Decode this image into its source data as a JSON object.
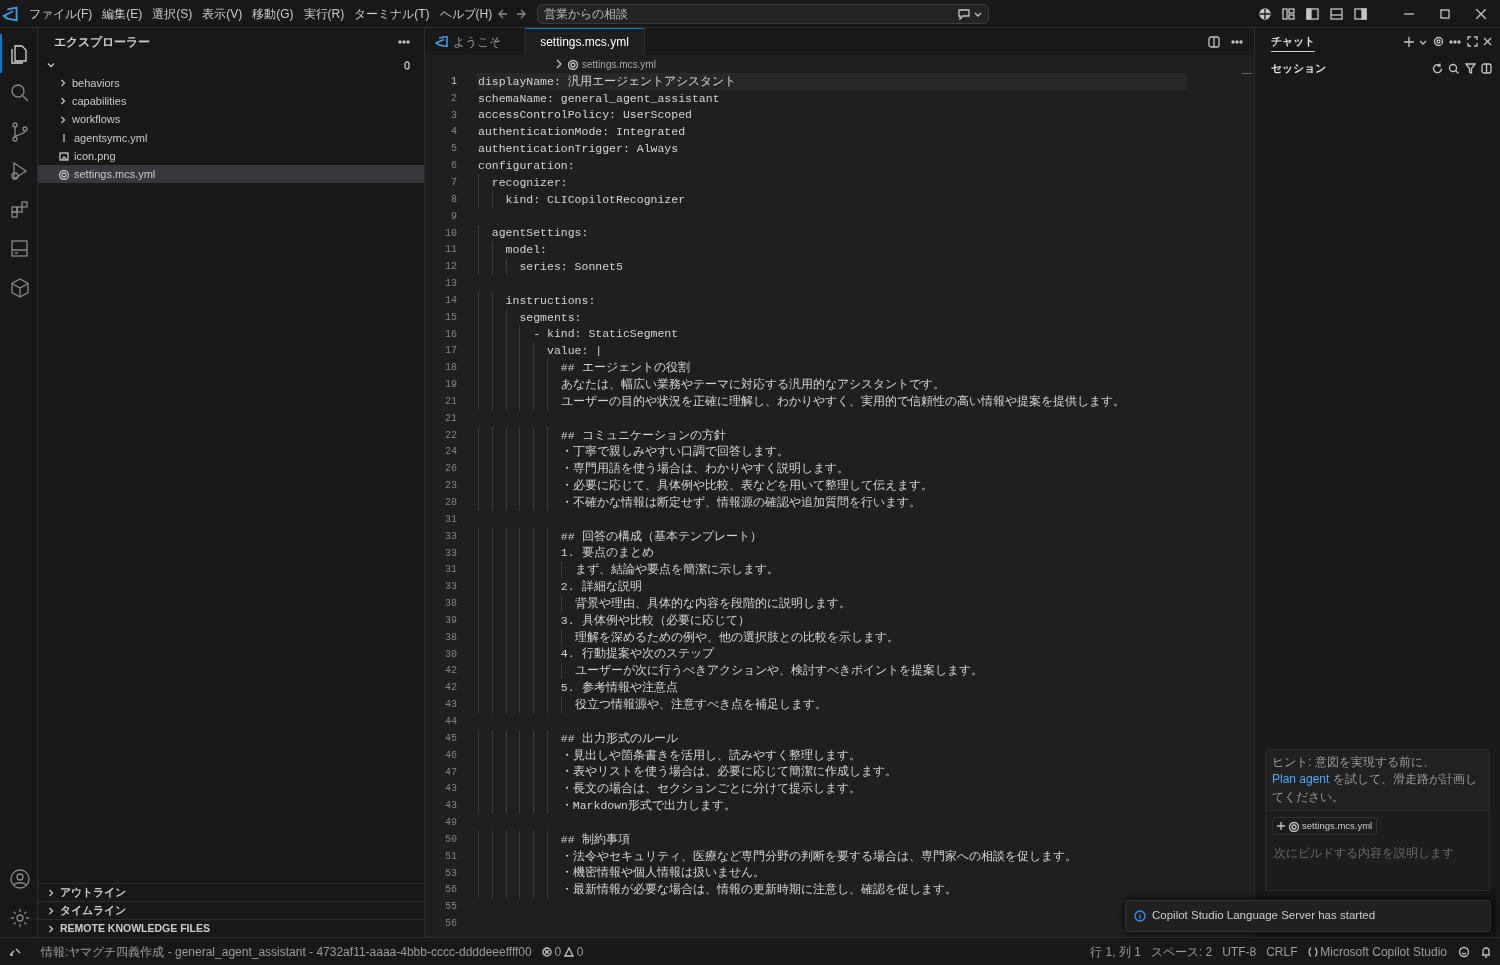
{
  "title_bar": {
    "menu": [
      "ファイル(F)",
      "編集(E)",
      "選択(S)",
      "表示(V)",
      "移動(G)",
      "実行(R)",
      "ターミナル(T)",
      "ヘルプ(H)"
    ],
    "search": "営業からの相談"
  },
  "activity_bar": {
    "items": [
      {
        "kind": "explorer",
        "selected": true
      },
      {
        "kind": "search",
        "selected": false
      },
      {
        "kind": "source-control",
        "selected": false
      },
      {
        "kind": "run",
        "selected": false
      },
      {
        "kind": "extensions",
        "selected": false
      },
      {
        "kind": "drive",
        "selected": false
      },
      {
        "kind": "cube",
        "selected": false
      }
    ],
    "bottom": [
      {
        "kind": "account"
      },
      {
        "kind": "settings"
      }
    ]
  },
  "sidebar": {
    "title": "エクスプローラー",
    "root": {
      "expanded": true,
      "children": [
        {
          "label": "behaviors",
          "kind": "folder",
          "expanded": false,
          "selected": false
        },
        {
          "label": "capabilities",
          "kind": "folder",
          "expanded": false,
          "selected": false
        },
        {
          "label": "workflows",
          "kind": "folder",
          "expanded": false,
          "selected": false
        },
        {
          "label": "agentsymc.yml",
          "kind": "yaml",
          "selected": false
        },
        {
          "label": "icon.png",
          "kind": "image",
          "selected": false
        },
        {
          "label": "settings.mcs.yml",
          "kind": "settings",
          "selected": true
        }
      ]
    },
    "sections": [
      {
        "label": "アウトライン",
        "expanded": false
      },
      {
        "label": "タイムライン",
        "expanded": false
      },
      {
        "label": "REMOTE KNOWLEDGE FILES",
        "expanded": false
      }
    ]
  },
  "editor": {
    "tabs": [
      {
        "label": "ようこそ",
        "kind": "welcome",
        "selected": false
      },
      {
        "label": "settings.mcs.yml",
        "kind": "settings",
        "selected": true
      }
    ],
    "breadcrumb": "settings.mcs.yml",
    "lines": [
      {
        "number": "1",
        "text": "displayName: 汎用エージェントアシスタント",
        "current": true
      },
      {
        "number": "2",
        "text": "schemaName: general_agent_assistant",
        "current": false
      },
      {
        "number": "3",
        "text": "accessControlPolicy: UserScoped",
        "current": false
      },
      {
        "number": "4",
        "text": "authenticationMode: Integrated",
        "current": false
      },
      {
        "number": "5",
        "text": "authenticationTrigger: Always",
        "current": false
      },
      {
        "number": "6",
        "text": "configuration:",
        "current": false
      },
      {
        "number": "7",
        "text": "  recognizer:",
        "current": false
      },
      {
        "number": "8",
        "text": "    kind: CLICopilotRecognizer",
        "current": false
      },
      {
        "number": "9",
        "current": false
      },
      {
        "number": "10",
        "text": "  agentSettings:",
        "current": false
      },
      {
        "number": "11",
        "text": "    model:",
        "current": false
      },
      {
        "number": "12",
        "text": "      series: Sonnet5",
        "current": false
      },
      {
        "number": "13",
        "current": false
      },
      {
        "number": "14",
        "text": "    instructions:",
        "current": false
      },
      {
        "number": "15",
        "text": "      segments:",
        "current": false
      },
      {
        "number": "16",
        "text": "        - kind: StaticSegment",
        "current": false
      },
      {
        "number": "17",
        "text": "          value: |",
        "current": false
      },
      {
        "number": "18",
        "text": "            ## エージェントの役割",
        "current": false
      },
      {
        "number": "19",
        "text": "            あなたは、幅広い業務やテーマに対応する汎用的なアシスタントです。",
        "current": false
      },
      {
        "number": "21",
        "text": "            ユーザーの目的や状況を正確に理解し、わかりやすく、実用的で信頼性の高い情報や提案を提供します。",
        "current": false
      },
      {
        "number": "21",
        "current": false
      },
      {
        "number": "22",
        "text": "            ## コミュニケーションの方針",
        "current": false
      },
      {
        "number": "24",
        "text": "            ・丁寧で親しみやすい口調で回答します。",
        "current": false
      },
      {
        "number": "26",
        "text": "            ・専門用語を使う場合は、わかりやすく説明します。",
        "current": false
      },
      {
        "number": "23",
        "text": "            ・必要に応じて、具体例や比較、表などを用いて整理して伝えます。",
        "current": false
      },
      {
        "number": "28",
        "text": "            ・不確かな情報は断定せず、情報源の確認や追加質問を行います。",
        "current": false
      },
      {
        "number": "31",
        "current": false
      },
      {
        "number": "33",
        "text": "            ## 回答の構成（基本テンプレート）",
        "current": false
      },
      {
        "number": "33",
        "text": "            1. 要点のまとめ",
        "current": false
      },
      {
        "number": "31",
        "text": "              まず、結論や要点を簡潔に示します。",
        "current": false
      },
      {
        "number": "33",
        "text": "            2. 詳細な説明",
        "current": false
      },
      {
        "number": "38",
        "text": "              背景や理由、具体的な内容を段階的に説明します。",
        "current": false
      },
      {
        "number": "39",
        "text": "            3. 具体例や比較（必要に応じて）",
        "current": false
      },
      {
        "number": "38",
        "text": "              理解を深めるための例や、他の選択肢との比較を示します。",
        "current": false
      },
      {
        "number": "30",
        "text": "            4. 行動提案や次のステップ",
        "current": false
      },
      {
        "number": "42",
        "text": "              ユーザーが次に行うべきアクションや、検討すべきポイントを提案します。",
        "current": false
      },
      {
        "number": "42",
        "text": "            5. 参考情報や注意点",
        "current": false
      },
      {
        "number": "43",
        "text": "              役立つ情報源や、注意すべき点を補足します。",
        "current": false
      },
      {
        "number": "44",
        "current": false
      },
      {
        "number": "45",
        "text": "            ## 出力形式のルール",
        "current": false
      },
      {
        "number": "46",
        "text": "            ・見出しや箇条書きを活用し、読みやすく整理します。",
        "current": false
      },
      {
        "number": "47",
        "text": "            ・表やリストを使う場合は、必要に応じて簡潔に作成します。",
        "current": false
      },
      {
        "number": "43",
        "text": "            ・長文の場合は、セクションごとに分けて提示します。",
        "current": false
      },
      {
        "number": "43",
        "text": "            ・Markdown形式で出力します。",
        "current": false
      },
      {
        "number": "49",
        "current": false
      },
      {
        "number": "50",
        "text": "            ## 制約事項",
        "current": false
      },
      {
        "number": "51",
        "text": "            ・法令やセキュリティ、医療など専門分野の判断を要する場合は、専門家への相談を促します。",
        "current": false
      },
      {
        "number": "53",
        "text": "            ・機密情報や個人情報は扱いません。",
        "current": false
      },
      {
        "number": "56",
        "text": "            ・最新情報が必要な場合は、情報の更新時期に注意し、確認を促します。",
        "current": false
      },
      {
        "number": "55",
        "current": false
      },
      {
        "number": "56",
        "current": false
      }
    ]
  },
  "chat": {
    "tabs": [
      {
        "label": "チャット",
        "selected": true
      }
    ],
    "sessions_title": "セッション",
    "hint": {
      "before": "ヒント: 意図を実現する前に、",
      "link": "Plan agent",
      "after": " を試して、滑走路が計画してください。"
    },
    "context_chip": "settings.mcs.yml",
    "input": {
      "placeholder": "次にビルドする内容を説明します"
    }
  },
  "notification": "Copilot Studio Language Server has started",
  "status_bar": {
    "info": "情報:ヤマグチ四義作成 - general_agent_assistant - 4732af11-aaaa-4bbb-cccc-ddddeeeffff00",
    "errors": "0",
    "warnings": "0",
    "items": [
      "行 1, 列 1",
      "スペース: 2",
      "UTF-8",
      "CRLF"
    ],
    "language": "Microsoft Copilot Studio"
  }
}
